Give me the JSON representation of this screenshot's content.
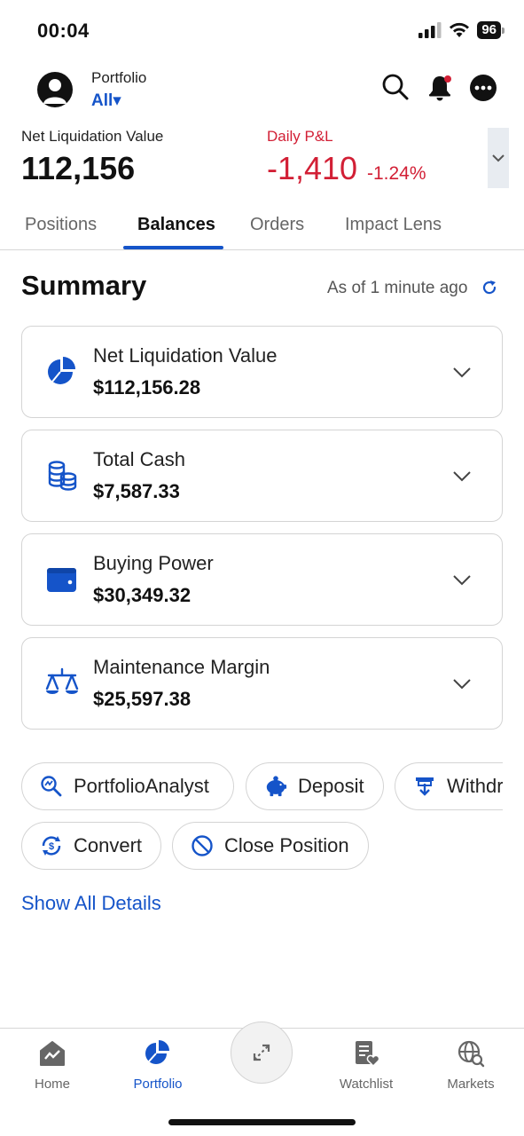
{
  "status_bar": {
    "time": "00:04",
    "battery": "96"
  },
  "header": {
    "portfolio_caption": "Portfolio",
    "portfolio_selected": "All▾"
  },
  "totals": {
    "nlv_label": "Net Liquidation Value",
    "nlv_value": "112,156",
    "pnl_label": "Daily P&L",
    "pnl_value": "-1,410",
    "pnl_pct": "-1.24%"
  },
  "tabs": [
    {
      "label": "Positions"
    },
    {
      "label": "Balances"
    },
    {
      "label": "Orders"
    },
    {
      "label": "Impact Lens"
    }
  ],
  "active_tab": "Balances",
  "summary": {
    "title": "Summary",
    "as_of": "As of 1 minute ago",
    "cards": [
      {
        "label": "Net Liquidation Value",
        "value": "$112,156.28",
        "icon": "pie-chart-icon"
      },
      {
        "label": "Total Cash",
        "value": "$7,587.33",
        "icon": "coins-icon"
      },
      {
        "label": "Buying Power",
        "value": "$30,349.32",
        "icon": "wallet-icon"
      },
      {
        "label": "Maintenance Margin",
        "value": "$25,597.38",
        "icon": "scale-icon"
      }
    ]
  },
  "actions": [
    {
      "label": "PortfolioAnalyst",
      "icon": "analyst-icon"
    },
    {
      "label": "Deposit",
      "icon": "piggy-bank-icon"
    },
    {
      "label": "Withdraw",
      "icon": "withdraw-icon"
    },
    {
      "label": "Convert",
      "icon": "currency-convert-icon"
    },
    {
      "label": "Close Position",
      "icon": "prohibited-icon"
    }
  ],
  "show_all_details": "Show All Details",
  "bottom_nav": [
    {
      "label": "Home",
      "icon": "home-chart-icon"
    },
    {
      "label": "Portfolio",
      "icon": "pie-chart-icon"
    },
    {
      "label": "Watchlist",
      "icon": "watchlist-icon"
    },
    {
      "label": "Markets",
      "icon": "globe-search-icon"
    }
  ],
  "colors": {
    "accent": "#1554c9",
    "loss": "#d21f35",
    "text": "#111111",
    "border": "#d4d4d4"
  }
}
